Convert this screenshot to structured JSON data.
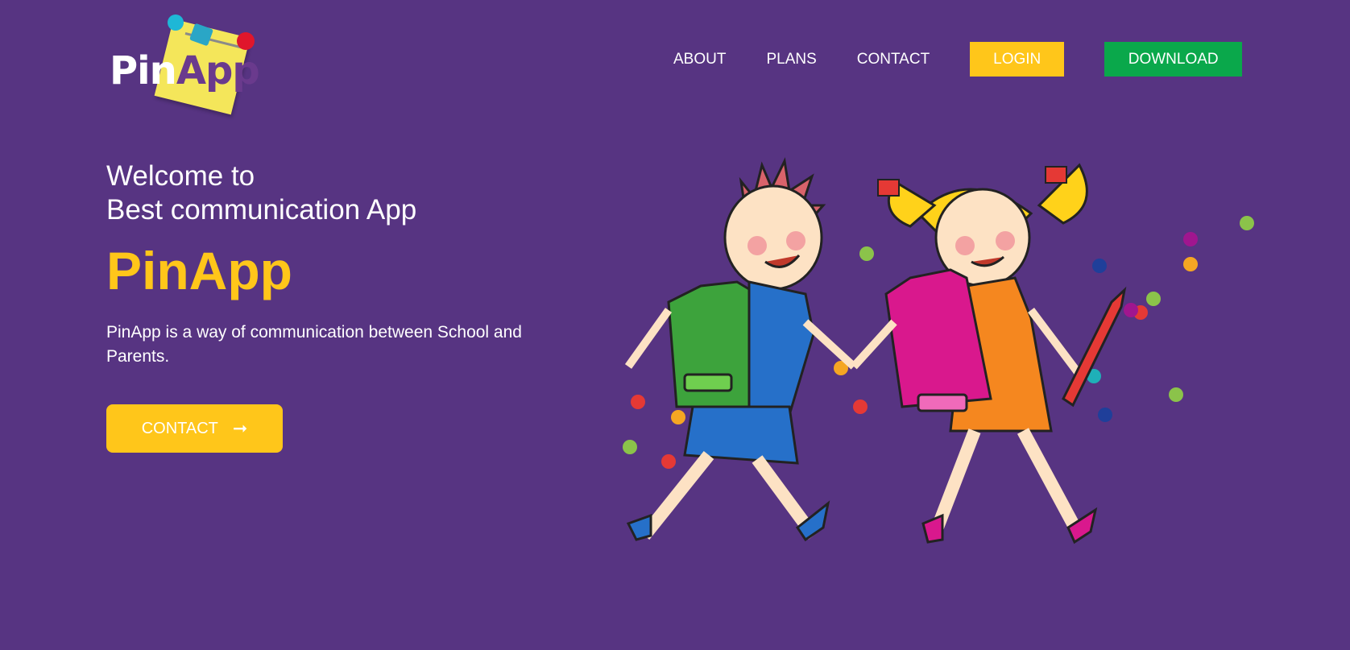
{
  "logo": {
    "word_part1": "Pin",
    "word_part2": "App"
  },
  "nav": {
    "about": "ABOUT",
    "plans": "PLANS",
    "contact": "CONTACT",
    "login": "LOGIN",
    "download": "DOWNLOAD"
  },
  "hero": {
    "welcome_line1": "Welcome to",
    "welcome_line2": "Best communication App",
    "brand": "PinApp",
    "description": "PinApp is a way of communication between School and Parents.",
    "contact_button": "CONTACT",
    "contact_arrow": "➞"
  },
  "colors": {
    "background": "#573482",
    "accent_yellow": "#ffc61a",
    "download_green": "#0aa84b"
  },
  "icons": [
    "pushpin-icon",
    "arrow-right-icon"
  ]
}
